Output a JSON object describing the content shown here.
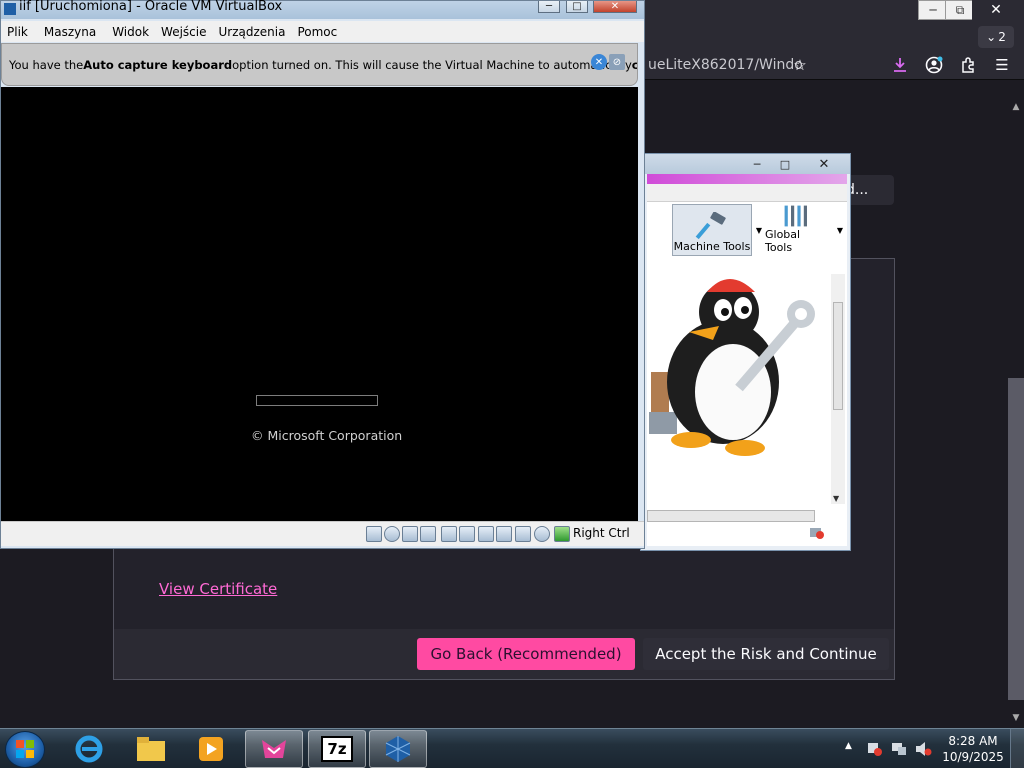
{
  "firefox": {
    "url_fragment": "ueLiteX862017/Windo",
    "tab_count": "2",
    "advanced_label": "d...",
    "view_certificate": "View Certificate",
    "go_back_label": "Go Back (Recommended)",
    "accept_label": "Accept the Risk and Continue",
    "accent_color": "#ff4aa2"
  },
  "vm_window": {
    "title": "iif [Uruchomiona] - Oracle VM VirtualBox",
    "menu": [
      "Plik",
      "Maszyna",
      "Widok",
      "Wejście",
      "Urządzenia",
      "Pomoc"
    ],
    "notice_prefix": "You have the ",
    "notice_bold1": "Auto capture keyboard",
    "notice_mid": " option turned on. This will cause the Virtual Machine to automatically ",
    "notice_bold2": "capture",
    "boot_text": "© Microsoft Corporation",
    "host_key": "Right Ctrl"
  },
  "vbox_manager": {
    "machine_tools": "Machine Tools",
    "global_tools": "Global Tools"
  },
  "taskbar": {
    "time": "8:28 AM",
    "date": "10/9/2025",
    "pinned": [
      "internet-explorer",
      "windows-explorer",
      "media-player",
      "firefox",
      "7zip",
      "virtualbox"
    ]
  }
}
